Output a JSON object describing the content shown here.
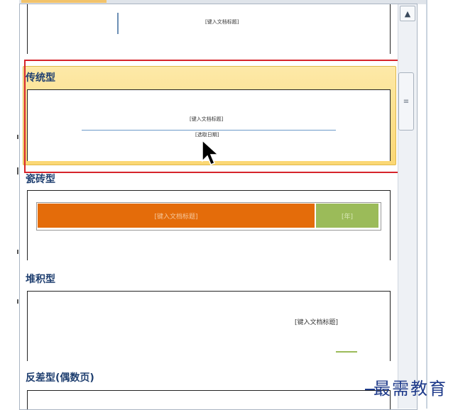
{
  "gallery": {
    "items": [
      {
        "label": "",
        "thumb_title": "[键入文档标题]"
      },
      {
        "label": "传统型",
        "thumb_title": "[键入文档标题]",
        "thumb_date": "[选取日期]"
      },
      {
        "label": "瓷砖型",
        "thumb_title": "[键入文档标题]",
        "thumb_year": "[年]"
      },
      {
        "label": "堆积型",
        "thumb_title": "[键入文档标题]"
      },
      {
        "label": "反差型(偶数页)"
      }
    ],
    "hovered_item": "传统型"
  },
  "scrollbar": {
    "up_arrow": "▲",
    "thumb_grip": "≡"
  },
  "watermark": {
    "text": "最需教育"
  },
  "colors": {
    "highlight": "#d6242b",
    "hover": "#fbd774",
    "tile_orange": "#e46c0a",
    "tile_green": "#9bbb59",
    "label": "#1f3f70"
  }
}
